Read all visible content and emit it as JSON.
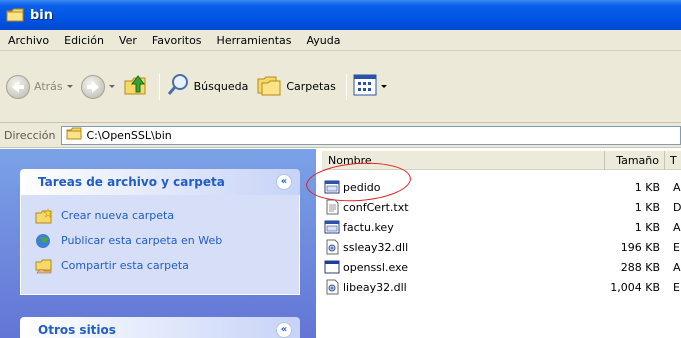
{
  "window": {
    "title": "bin"
  },
  "menu": [
    "Archivo",
    "Edición",
    "Ver",
    "Favoritos",
    "Herramientas",
    "Ayuda"
  ],
  "toolbar": {
    "back_label": "Atrás",
    "search_label": "Búsqueda",
    "folders_label": "Carpetas"
  },
  "address": {
    "label": "Dirección",
    "path": "C:\\OpenSSL\\bin"
  },
  "tasks_panel": {
    "title": "Tareas de archivo y carpeta",
    "items": [
      "Crear nueva carpeta",
      "Publicar esta carpeta en Web",
      "Compartir esta carpeta"
    ]
  },
  "other_panel": {
    "title": "Otros sitios"
  },
  "columns": {
    "name": "Nombre",
    "size": "Tamaño",
    "type": "T"
  },
  "files": [
    {
      "name": "pedido",
      "size": "1 KB",
      "type": "A",
      "icon": "keyfile-icon"
    },
    {
      "name": "confCert.txt",
      "size": "1 KB",
      "type": "D",
      "icon": "text-file-icon"
    },
    {
      "name": "factu.key",
      "size": "1 KB",
      "type": "A",
      "icon": "keyfile-icon"
    },
    {
      "name": "ssleay32.dll",
      "size": "196 KB",
      "type": "E",
      "icon": "dll-icon"
    },
    {
      "name": "openssl.exe",
      "size": "288 KB",
      "type": "A",
      "icon": "exe-icon"
    },
    {
      "name": "libeay32.dll",
      "size": "1,004 KB",
      "type": "E",
      "icon": "dll-icon"
    }
  ]
}
